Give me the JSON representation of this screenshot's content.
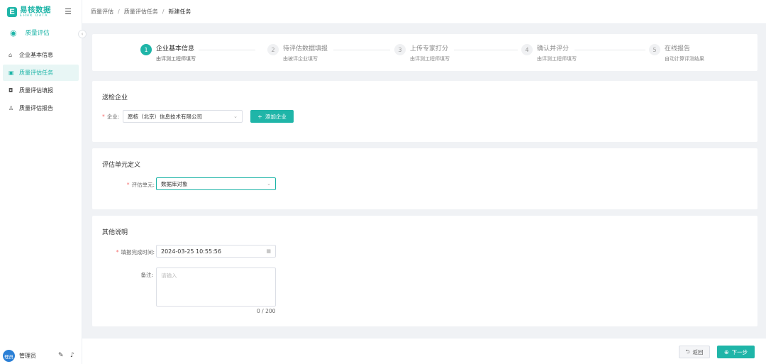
{
  "brand": {
    "name_cn": "易核数据",
    "name_en": "EHHK DATA",
    "icon": "logo-e-icon"
  },
  "sidebar": {
    "module_title": "质量评估",
    "items": [
      {
        "label": "企业基本信息",
        "icon": "building-icon",
        "active": false
      },
      {
        "label": "质量评估任务",
        "icon": "task-icon",
        "active": true
      },
      {
        "label": "质量评估填报",
        "icon": "chat-icon",
        "active": false
      },
      {
        "label": "质量评估报告",
        "icon": "user-report-icon",
        "active": false
      }
    ],
    "user": {
      "avatar_text": "理员",
      "name": "管理员"
    }
  },
  "breadcrumb": [
    "质量评估",
    "质量评估任务",
    "新建任务"
  ],
  "steps": [
    {
      "num": "1",
      "title": "企业基本信息",
      "desc": "由评测工程师填写",
      "active": true
    },
    {
      "num": "2",
      "title": "待评估数据填报",
      "desc": "由被评企业填写",
      "active": false
    },
    {
      "num": "3",
      "title": "上传专家打分",
      "desc": "由评测工程师填写",
      "active": false
    },
    {
      "num": "4",
      "title": "确认并评分",
      "desc": "由评测工程师填写",
      "active": false
    },
    {
      "num": "5",
      "title": "在线报告",
      "desc": "自动计算评测结果",
      "active": false
    }
  ],
  "section_company": {
    "title": "送检企业",
    "label": "企业:",
    "value": "愿核（北京）信息技术有限公司",
    "add_button": "添加企业"
  },
  "section_unit": {
    "title": "评估单元定义",
    "label": "评估单元:",
    "value": "数据库对象"
  },
  "section_other": {
    "title": "其他说明",
    "time_label": "填报完成时间:",
    "time_value": "2024-03-25 10:55:56",
    "note_label": "备注:",
    "note_placeholder": "请输入",
    "counter": "0 / 200"
  },
  "footer": {
    "back": "返回",
    "next": "下一步"
  },
  "colors": {
    "accent": "#1fb5a8",
    "required": "#f56c6c"
  }
}
